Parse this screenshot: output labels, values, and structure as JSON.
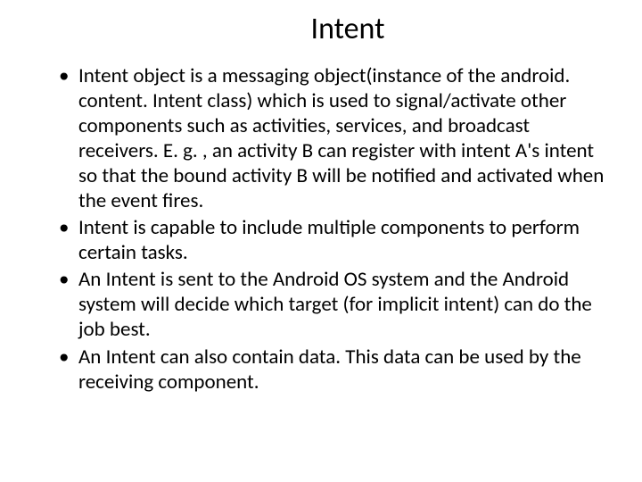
{
  "slide": {
    "title": "Intent",
    "bullets": [
      "Intent object is a messaging object(instance of the android. content. Intent class) which is used to signal/activate other components such as activities, services, and broadcast receivers. E. g. , an activity B can register with intent A's intent so that the bound activity B will be notified and activated when the event fires.",
      "Intent is capable to include multiple components to perform certain tasks.",
      "An Intent is sent to the Android OS system and the Android system will decide which target (for implicit intent) can do the job best.",
      "An Intent can also contain data. This data can be used by the receiving component."
    ]
  }
}
